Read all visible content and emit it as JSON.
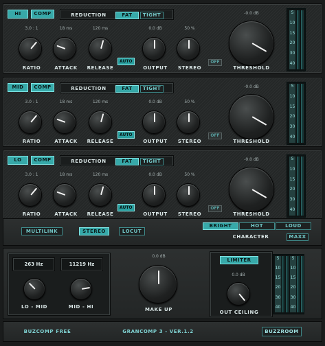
{
  "bands": [
    {
      "id": "hi",
      "band_label": "HI",
      "comp_label": "COMP",
      "reduction_label": "REDUCTION",
      "fat_label": "FAT",
      "tight_label": "TIGHT",
      "ratio_value": "3.0 : 1",
      "attack_value": "18 ms",
      "release_value": "120 ms",
      "output_value": "0.0 dB",
      "stereo_value": "50 %",
      "threshold_value": "-0.0 dB",
      "ratio_label": "RATIO",
      "attack_label": "ATTACK",
      "release_label": "RELEASE",
      "auto_label": "AUTO",
      "output_label": "OUTPUT",
      "stereo_label": "STEREO",
      "off_label": "OFF",
      "threshold_label": "THRESHOLD"
    },
    {
      "id": "mid",
      "band_label": "MID",
      "comp_label": "COMP",
      "reduction_label": "REDUCTION",
      "fat_label": "FAT",
      "tight_label": "TIGHT",
      "ratio_value": "3.0 : 1",
      "attack_value": "18 ms",
      "release_value": "120 ms",
      "output_value": "0.0 dB",
      "stereo_value": "50 %",
      "threshold_value": "-0.0 dB",
      "ratio_label": "RATIO",
      "attack_label": "ATTACK",
      "release_label": "RELEASE",
      "auto_label": "AUTO",
      "output_label": "OUTPUT",
      "stereo_label": "STEREO",
      "off_label": "OFF",
      "threshold_label": "THRESHOLD"
    },
    {
      "id": "lo",
      "band_label": "LO",
      "comp_label": "COMP",
      "reduction_label": "REDUCTION",
      "fat_label": "FAT",
      "tight_label": "TIGHT",
      "ratio_value": "3.0 : 1",
      "attack_value": "18 ms",
      "release_value": "120 ms",
      "output_value": "0.0 dB",
      "stereo_value": "50 %",
      "threshold_value": "-0.0 dB",
      "ratio_label": "RATIO",
      "attack_label": "ATTACK",
      "release_label": "RELEASE",
      "auto_label": "AUTO",
      "output_label": "OUTPUT",
      "stereo_label": "STEREO",
      "off_label": "OFF",
      "threshold_label": "THRESHOLD"
    }
  ],
  "meter_scale": [
    "5",
    "10",
    "15",
    "20",
    "30",
    "40"
  ],
  "options": {
    "multilink_label": "MULTILINK",
    "stereo_label": "STEREO",
    "locut_label": "LOCUT",
    "bright_label": "BRIGHT",
    "hot_label": "HOT",
    "loud_label": "LOUD",
    "character_label": "CHARACTER",
    "maxx_label": "MAXX"
  },
  "crossover": {
    "low_freq": "263 Hz",
    "high_freq": "11219 Hz",
    "lo_mid_label": "LO - MID",
    "mid_hi_label": "MID - HI"
  },
  "makeup": {
    "value": "0.0 dB",
    "label": "MAKE UP"
  },
  "limiter": {
    "button_label": "LIMITER",
    "ceiling_value": "0.0 dB",
    "ceiling_label": "OUT CEILING"
  },
  "footer": {
    "left_text": "BUZCOMP FREE",
    "center_text": "GRANCOMP 3  -  VER.1.2",
    "right_button": "BUZZROOM"
  },
  "colors": {
    "accent": "#37a9a9",
    "background": "#1a1c1c",
    "text": "#d8e4e4"
  }
}
